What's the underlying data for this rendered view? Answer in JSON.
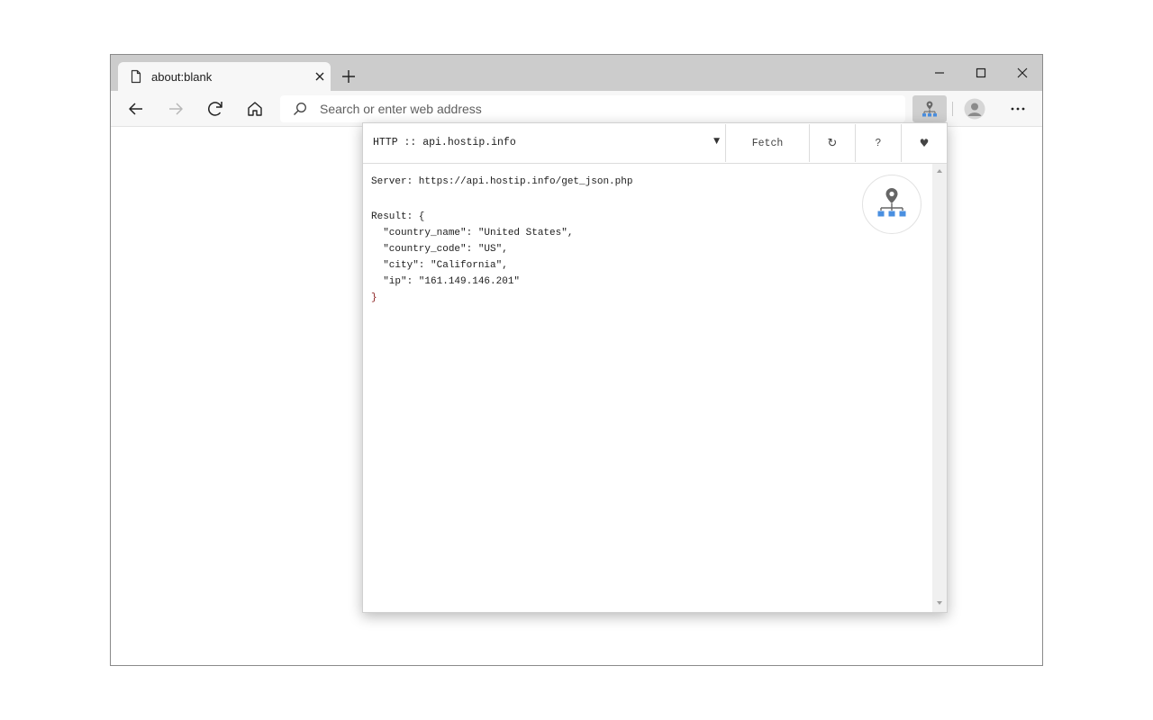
{
  "browser": {
    "tab": {
      "title": "about:blank"
    },
    "address_bar": {
      "placeholder": "Search or enter web address",
      "value": ""
    },
    "icons": {
      "page": "page-icon",
      "close": "close-icon",
      "new_tab": "plus-icon",
      "back": "back-arrow-icon",
      "forward": "forward-arrow-icon",
      "refresh": "refresh-icon",
      "home": "home-icon",
      "search": "search-icon",
      "extension": "location-network-icon",
      "profile": "profile-icon",
      "menu": "more-dots-icon"
    }
  },
  "extension_popup": {
    "service_select": {
      "selected": "HTTP :: api.hostip.info"
    },
    "buttons": {
      "fetch": "Fetch",
      "refresh": "↻",
      "help": "?",
      "favorite": "♥"
    },
    "server_line": "Server: https://api.hostip.info/get_json.php",
    "result": {
      "open": "Result: {",
      "fields": [
        "\"country_name\": \"United States\",",
        "\"country_code\": \"US\",",
        "\"city\": \"California\",",
        "\"ip\": \"161.149.146.201\""
      ],
      "close": "}"
    },
    "colors": {
      "accent": "#4a8fe0",
      "pin": "#666666",
      "brace": "#8b2020"
    }
  }
}
